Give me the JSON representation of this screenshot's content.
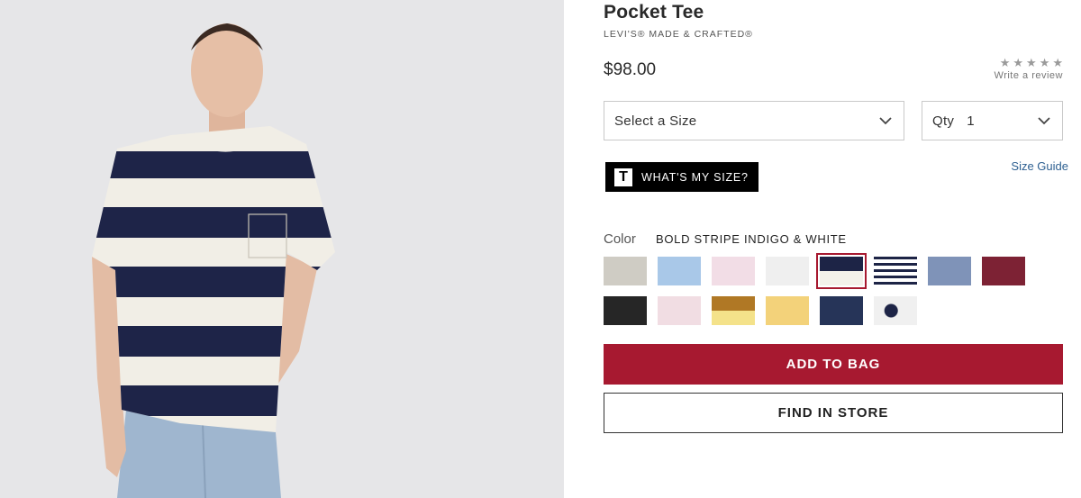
{
  "product": {
    "title": "Pocket Tee",
    "brand": "LEVI'S® MADE & CRAFTED®",
    "price": "$98.00",
    "rating": {
      "stars": 5,
      "filled": 0,
      "review_link": "Write a review"
    }
  },
  "size_select": {
    "label": "Select a Size",
    "icon": "chevron-down-icon"
  },
  "qty_select": {
    "label": "Qty",
    "value": "1",
    "icon": "chevron-down-icon"
  },
  "fit_button": {
    "logo": "T",
    "label": "WHAT'S MY SIZE?"
  },
  "size_guide": "Size Guide",
  "color": {
    "label": "Color",
    "selected_name": "BOLD STRIPE INDIGO & WHITE",
    "swatches": [
      {
        "name": "oatmeal-heather",
        "colors": [
          "#cfccc4"
        ]
      },
      {
        "name": "light-blue",
        "colors": [
          "#a9c8e8"
        ]
      },
      {
        "name": "pink-tie-dye",
        "colors": [
          "#f2dde6"
        ]
      },
      {
        "name": "white",
        "colors": [
          "#efefef"
        ]
      },
      {
        "name": "bold-stripe-indigo-white",
        "colors": [
          "#1d2446",
          "#f3f1ea"
        ],
        "selected": true
      },
      {
        "name": "thin-stripe-navy-white",
        "colors": [
          "#1d2446",
          "#ffffff"
        ]
      },
      {
        "name": "heather-blue",
        "colors": [
          "#7f93b8"
        ]
      },
      {
        "name": "burgundy",
        "colors": [
          "#7d2234"
        ]
      },
      {
        "name": "black",
        "colors": [
          "#262626"
        ]
      },
      {
        "name": "light-pink",
        "colors": [
          "#f1dde3"
        ]
      },
      {
        "name": "mustard-yellow-colorblock",
        "colors": [
          "#b07825",
          "#f4e28a"
        ]
      },
      {
        "name": "yellow",
        "colors": [
          "#f3d27a"
        ]
      },
      {
        "name": "navy",
        "colors": [
          "#263458"
        ]
      },
      {
        "name": "sunrise-graphic",
        "colors": [
          "#f0f0f0",
          "#1d2446"
        ]
      }
    ]
  },
  "actions": {
    "add_to_bag": "ADD TO BAG",
    "find_in_store": "FIND IN STORE"
  },
  "accent_color": "#a71930",
  "link_color": "#2d5f91"
}
